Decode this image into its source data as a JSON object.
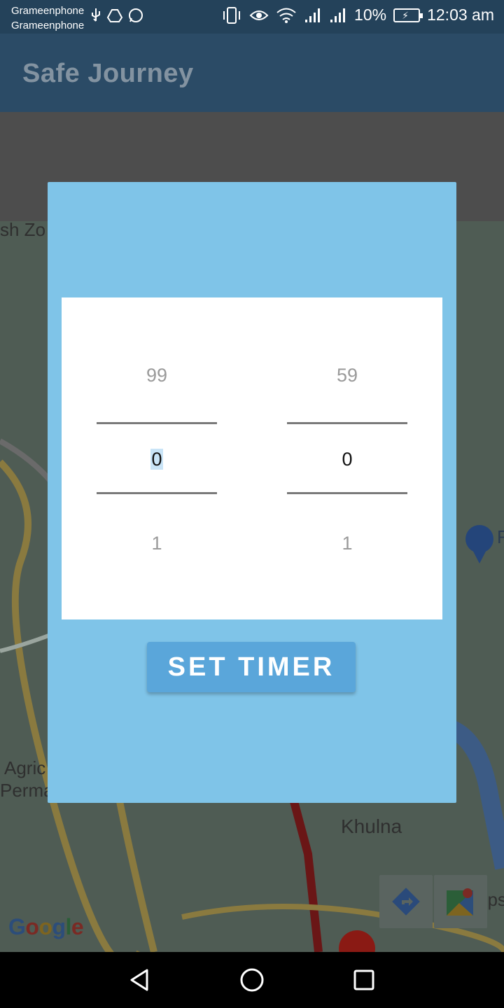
{
  "status_bar": {
    "carrier_1": "Grameenphone",
    "carrier_2": "Grameenphone",
    "battery": "10%",
    "time": "12:03 am"
  },
  "app_bar": {
    "title": "Safe Journey"
  },
  "map": {
    "labels": {
      "top_left": "sh Zo",
      "agri_1": "Agric",
      "agri_2": "Perma",
      "city": "Khulna",
      "right_edge": "R",
      "bottom_right": "ops"
    },
    "google_logo": [
      "G",
      "o",
      "o",
      "g",
      "l",
      "e"
    ],
    "google_colors": [
      "#4285f4",
      "#ea4335",
      "#fbbc05",
      "#4285f4",
      "#34a853",
      "#ea4335"
    ]
  },
  "dialog": {
    "hours": {
      "prev": "99",
      "current": "0",
      "next": "1"
    },
    "minutes": {
      "prev": "59",
      "current": "0",
      "next": "1"
    },
    "set_timer_label": "SET TIMER"
  }
}
